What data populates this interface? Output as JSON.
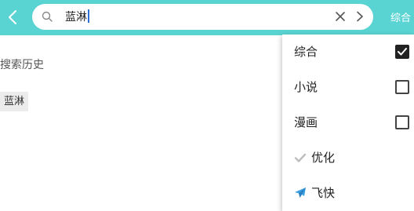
{
  "colors": {
    "accent": "#5ad3d3",
    "caret": "#2b6fd6",
    "plane": "#3aa0e0"
  },
  "search": {
    "value": "蓝淋"
  },
  "header": {
    "right_label": "综合"
  },
  "history": {
    "title": "搜索历史",
    "items": [
      "蓝淋"
    ]
  },
  "menu": {
    "items": [
      {
        "label": "综合",
        "type": "checkbox",
        "checked": true
      },
      {
        "label": "小说",
        "type": "checkbox",
        "checked": false
      },
      {
        "label": "漫画",
        "type": "checkbox",
        "checked": false
      },
      {
        "label": "优化",
        "type": "action",
        "icon": "check-icon"
      },
      {
        "label": "飞快",
        "type": "action",
        "icon": "airplane-icon"
      }
    ]
  }
}
